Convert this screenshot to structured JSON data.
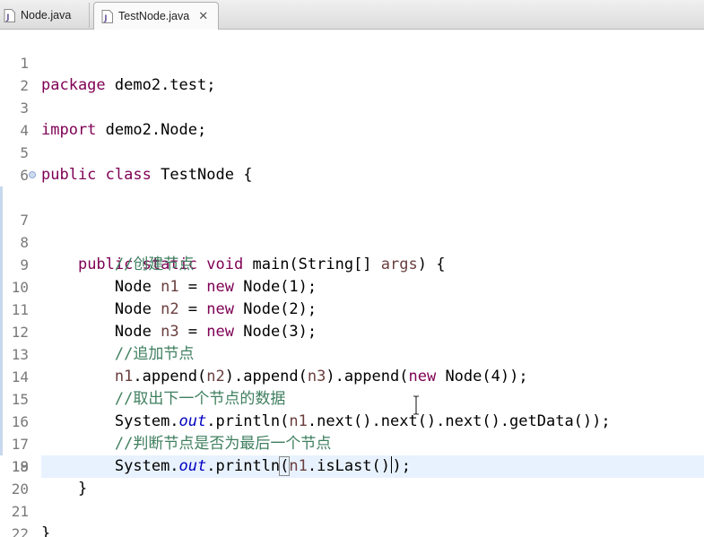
{
  "tabs": [
    {
      "label": "Node.java",
      "active": false,
      "icon": "java-file-icon"
    },
    {
      "label": "TestNode.java",
      "active": true,
      "icon": "java-file-icon",
      "close": "✕"
    }
  ],
  "editor": {
    "current_line": 17,
    "lines": [
      {
        "num": "1",
        "t": {
          "a": "package",
          "b": " demo2.test;"
        }
      },
      {
        "num": "2"
      },
      {
        "num": "3",
        "t": {
          "a": "import",
          "b": " demo2.Node;"
        }
      },
      {
        "num": "4"
      },
      {
        "num": "5",
        "t": {
          "a": "public",
          "b": " ",
          "c": "class",
          "d": " TestNode {"
        }
      },
      {
        "num": "6"
      },
      {
        "num": "7",
        "t": {
          "i": "    ",
          "a": "public",
          "b": " ",
          "c": "static",
          "d": " ",
          "e": "void",
          "f": " main(String[] ",
          "g": "args",
          "h": ") {"
        }
      },
      {
        "num": "8",
        "t": {
          "i": "        ",
          "a": "//创建节点"
        }
      },
      {
        "num": "9",
        "t": {
          "i": "        ",
          "a": "Node ",
          "b": "n1",
          "c": " = ",
          "d": "new",
          "e": " Node(1);"
        }
      },
      {
        "num": "10",
        "t": {
          "i": "        ",
          "a": "Node ",
          "b": "n2",
          "c": " = ",
          "d": "new",
          "e": " Node(2);"
        }
      },
      {
        "num": "11",
        "t": {
          "i": "        ",
          "a": "Node ",
          "b": "n3",
          "c": " = ",
          "d": "new",
          "e": " Node(3);"
        }
      },
      {
        "num": "12",
        "t": {
          "i": "        ",
          "a": "//追加节点"
        }
      },
      {
        "num": "13",
        "t": {
          "i": "        ",
          "a": "n1",
          "b": ".append(",
          "c": "n2",
          "d": ").append(",
          "e": "n3",
          "f": ").append(",
          "g": "new",
          "h": " Node(4));"
        }
      },
      {
        "num": "14",
        "t": {
          "i": "        ",
          "a": "//取出下一个节点的数据"
        }
      },
      {
        "num": "15",
        "t": {
          "i": "        ",
          "a": "System.",
          "b": "out",
          "c": ".println(",
          "d": "n1",
          "e": ".next().next().next().getData());"
        }
      },
      {
        "num": "16",
        "t": {
          "i": "        ",
          "a": "//判断节点是否为最后一个节点"
        }
      },
      {
        "num": "17",
        "t": {
          "i": "        ",
          "a": "System.",
          "b": "out",
          "c": ".println",
          "d": "(",
          "e": "n1",
          "f": ".isLast()",
          "g": ")",
          "h": ";"
        }
      },
      {
        "num": "18"
      },
      {
        "num": "19",
        "t": {
          "i": "    ",
          "a": "}"
        }
      },
      {
        "num": "20"
      },
      {
        "num": "21",
        "t": {
          "a": "}"
        }
      },
      {
        "num": "22"
      }
    ]
  },
  "colors": {
    "keyword": "#7f0055",
    "comment": "#3f7f5f",
    "static_field": "#0000c0",
    "local_variable": "#6a3e3e",
    "current_line_highlight": "#e8f2fe"
  }
}
